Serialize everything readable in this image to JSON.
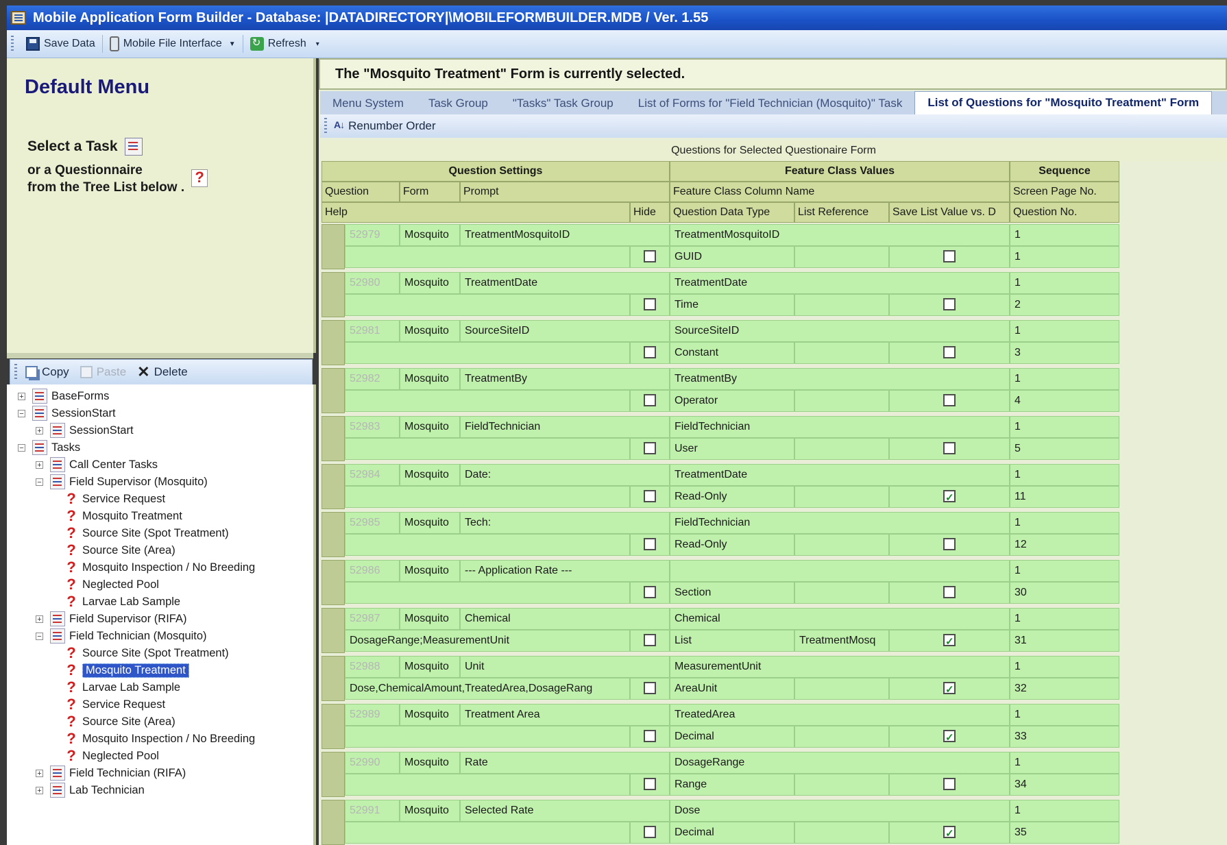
{
  "window": {
    "title": "Mobile Application Form Builder - Database:  |DATADIRECTORY|\\MOBILEFORMBUILDER.MDB /  Ver. 1.55"
  },
  "toolbar": {
    "save": "Save Data",
    "mobile": "Mobile File Interface",
    "refresh": "Refresh"
  },
  "left": {
    "menu_title": "Default Menu",
    "select_task": "Select a Task",
    "or_questionnaire_1": "or a Questionnaire",
    "or_questionnaire_2": "from the Tree List below .",
    "tools": {
      "copy": "Copy",
      "paste": "Paste",
      "delete": "Delete"
    }
  },
  "tree": [
    {
      "label": "BaseForms",
      "level": 0,
      "kind": "folder",
      "expander": "+"
    },
    {
      "label": "SessionStart",
      "level": 0,
      "kind": "folder",
      "expander": "−"
    },
    {
      "label": "SessionStart",
      "level": 1,
      "kind": "folder",
      "expander": "+"
    },
    {
      "label": "Tasks",
      "level": 0,
      "kind": "folder",
      "expander": "−"
    },
    {
      "label": "Call Center Tasks",
      "level": 1,
      "kind": "folder",
      "expander": "+"
    },
    {
      "label": "Field Supervisor (Mosquito)",
      "level": 1,
      "kind": "folder",
      "expander": "−"
    },
    {
      "label": "Service Request",
      "level": 2,
      "kind": "form"
    },
    {
      "label": "Mosquito Treatment",
      "level": 2,
      "kind": "form"
    },
    {
      "label": "Source Site (Spot Treatment)",
      "level": 2,
      "kind": "form"
    },
    {
      "label": "Source Site (Area)",
      "level": 2,
      "kind": "form"
    },
    {
      "label": "Mosquito Inspection / No Breeding",
      "level": 2,
      "kind": "form"
    },
    {
      "label": "Neglected Pool",
      "level": 2,
      "kind": "form"
    },
    {
      "label": "Larvae Lab Sample",
      "level": 2,
      "kind": "form"
    },
    {
      "label": "Field Supervisor (RIFA)",
      "level": 1,
      "kind": "folder",
      "expander": "+"
    },
    {
      "label": "Field Technician (Mosquito)",
      "level": 1,
      "kind": "folder",
      "expander": "−"
    },
    {
      "label": "Source Site (Spot Treatment)",
      "level": 2,
      "kind": "form"
    },
    {
      "label": "Mosquito Treatment",
      "level": 2,
      "kind": "form",
      "selected": true
    },
    {
      "label": "Larvae Lab Sample",
      "level": 2,
      "kind": "form"
    },
    {
      "label": "Service Request",
      "level": 2,
      "kind": "form"
    },
    {
      "label": "Source Site (Area)",
      "level": 2,
      "kind": "form"
    },
    {
      "label": "Mosquito Inspection / No Breeding",
      "level": 2,
      "kind": "form"
    },
    {
      "label": "Neglected Pool",
      "level": 2,
      "kind": "form"
    },
    {
      "label": "Field Technician (RIFA)",
      "level": 1,
      "kind": "folder",
      "expander": "+"
    },
    {
      "label": "Lab Technician",
      "level": 1,
      "kind": "folder",
      "expander": "+"
    }
  ],
  "right": {
    "status": "The \"Mosquito Treatment\" Form is currently selected.",
    "tabs": [
      "Menu System",
      "Task Group",
      "\"Tasks\" Task Group",
      "List of Forms for \"Field Technician (Mosquito)\" Task",
      "List of Questions for \"Mosquito Treatment\" Form"
    ],
    "renumber": "Renumber Order",
    "caption": "Questions for Selected Questionaire Form"
  },
  "grid": {
    "group_headers": {
      "question_settings": "Question Settings",
      "feature_class_values": "Feature Class Values",
      "sequence": "Sequence"
    },
    "headers": {
      "question": "Question",
      "form": "Form",
      "prompt": "Prompt",
      "feature_class_column": "Feature Class Column Name",
      "screen_page": "Screen Page No.",
      "help": "Help",
      "hide": "Hide",
      "data_type": "Question Data Type",
      "list_ref": "List Reference",
      "save_list": "Save List Value vs. D",
      "question_no": "Question No."
    },
    "rows": [
      {
        "id": "52979",
        "form": "Mosquito",
        "prompt": "TreatmentMosquitoID",
        "column": "TreatmentMosquitoID",
        "page": "1",
        "help": "",
        "hide": false,
        "type": "GUID",
        "list_ref": "",
        "save": false,
        "qno": "1"
      },
      {
        "id": "52980",
        "form": "Mosquito",
        "prompt": "TreatmentDate",
        "column": "TreatmentDate",
        "page": "1",
        "help": "",
        "hide": false,
        "type": "Time",
        "list_ref": "",
        "save": false,
        "qno": "2"
      },
      {
        "id": "52981",
        "form": "Mosquito",
        "prompt": "SourceSiteID",
        "column": "SourceSiteID",
        "page": "1",
        "help": "",
        "hide": false,
        "type": "Constant",
        "list_ref": "",
        "save": false,
        "qno": "3"
      },
      {
        "id": "52982",
        "form": "Mosquito",
        "prompt": "TreatmentBy",
        "column": "TreatmentBy",
        "page": "1",
        "help": "",
        "hide": false,
        "type": "Operator",
        "list_ref": "",
        "save": false,
        "qno": "4"
      },
      {
        "id": "52983",
        "form": "Mosquito",
        "prompt": "FieldTechnician",
        "column": "FieldTechnician",
        "page": "1",
        "help": "",
        "hide": false,
        "type": "User",
        "list_ref": "",
        "save": false,
        "qno": "5"
      },
      {
        "id": "52984",
        "form": "Mosquito",
        "prompt": "Date:",
        "column": "TreatmentDate",
        "page": "1",
        "help": "",
        "hide": false,
        "type": "Read-Only",
        "list_ref": "",
        "save": true,
        "qno": "11"
      },
      {
        "id": "52985",
        "form": "Mosquito",
        "prompt": "Tech:",
        "column": "FieldTechnician",
        "page": "1",
        "help": "",
        "hide": false,
        "type": "Read-Only",
        "list_ref": "",
        "save": false,
        "qno": "12"
      },
      {
        "id": "52986",
        "form": "Mosquito",
        "prompt": "--- Application Rate ---",
        "column": "",
        "page": "1",
        "help": "",
        "hide": false,
        "type": "Section",
        "list_ref": "",
        "save": false,
        "qno": "30"
      },
      {
        "id": "52987",
        "form": "Mosquito",
        "prompt": "Chemical",
        "column": "Chemical",
        "page": "1",
        "help": "DosageRange;MeasurementUnit",
        "hide": false,
        "type": "List",
        "list_ref": "TreatmentMosq",
        "save": true,
        "qno": "31"
      },
      {
        "id": "52988",
        "form": "Mosquito",
        "prompt": "Unit",
        "column": "MeasurementUnit",
        "page": "1",
        "help": "Dose,ChemicalAmount,TreatedArea,DosageRang",
        "hide": false,
        "type": "AreaUnit",
        "list_ref": "",
        "save": true,
        "qno": "32"
      },
      {
        "id": "52989",
        "form": "Mosquito",
        "prompt": "Treatment Area",
        "column": "TreatedArea",
        "page": "1",
        "help": "",
        "hide": false,
        "type": "Decimal",
        "list_ref": "",
        "save": true,
        "qno": "33"
      },
      {
        "id": "52990",
        "form": "Mosquito",
        "prompt": "Rate",
        "column": "DosageRange",
        "page": "1",
        "help": "",
        "hide": false,
        "type": "Range",
        "list_ref": "",
        "save": false,
        "qno": "34"
      },
      {
        "id": "52991",
        "form": "Mosquito",
        "prompt": "Selected Rate",
        "column": "Dose",
        "page": "1",
        "help": "",
        "hide": false,
        "type": "Decimal",
        "list_ref": "",
        "save": true,
        "qno": "35"
      }
    ]
  }
}
